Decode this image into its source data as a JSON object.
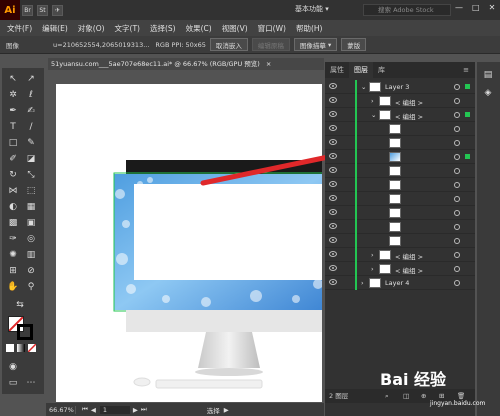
{
  "app": {
    "logo": "Ai"
  },
  "menu": {
    "items": [
      "文件(F)",
      "编辑(E)",
      "对象(O)",
      "文字(T)",
      "选择(S)",
      "效果(C)",
      "视图(V)",
      "窗口(W)",
      "帮助(H)"
    ],
    "workspace": "基本功能 ▾",
    "search_placeholder": "搜索 Adobe Stock",
    "mini_buttons": [
      "Br",
      "St"
    ]
  },
  "control_bar": {
    "label": "图像",
    "file_info": "u=210652554,2065019313...",
    "resolution": "RGB  PPI: 50x65",
    "embed_button": "取消嵌入",
    "edit_original": "编辑原稿",
    "image_trace": "图像描摹",
    "mask_button": "蒙版"
  },
  "document": {
    "tab_title": "51yuansu.com___5ae707e68ec11.ai*  @  66.67% (RGB/GPU 预览)",
    "close": "×"
  },
  "status": {
    "zoom": "66.67%",
    "page": "1",
    "mode": "选择"
  },
  "layers_panel": {
    "tabs": [
      "属性",
      "图层",
      "库"
    ],
    "active_tab": "图层",
    "rows": [
      {
        "name": "Layer 3",
        "indent": 0,
        "expanded": true,
        "selected_mark": true
      },
      {
        "name": "< 编组 >",
        "indent": 1,
        "expanded": false,
        "selected_mark": false
      },
      {
        "name": "< 编组 >",
        "indent": 1,
        "expanded": true,
        "selected_mark": true
      },
      {
        "name": "",
        "indent": 2,
        "expanded": false,
        "selected_mark": false
      },
      {
        "name": "",
        "indent": 2,
        "expanded": false,
        "selected_mark": false
      },
      {
        "name": "",
        "indent": 2,
        "expanded": false,
        "selected_mark": true
      },
      {
        "name": "",
        "indent": 2,
        "expanded": false,
        "selected_mark": false
      },
      {
        "name": "",
        "indent": 2,
        "expanded": false,
        "selected_mark": false
      },
      {
        "name": "",
        "indent": 2,
        "expanded": false,
        "selected_mark": false
      },
      {
        "name": "",
        "indent": 2,
        "expanded": false,
        "selected_mark": false
      },
      {
        "name": "",
        "indent": 2,
        "expanded": false,
        "selected_mark": false
      },
      {
        "name": "",
        "indent": 2,
        "expanded": false,
        "selected_mark": false
      },
      {
        "name": "< 编组 >",
        "indent": 1,
        "expanded": false,
        "selected_mark": false
      },
      {
        "name": "< 编组 >",
        "indent": 1,
        "expanded": false,
        "selected_mark": false
      },
      {
        "name": "Layer 4",
        "indent": 0,
        "expanded": false,
        "selected_mark": false
      }
    ],
    "footer": "2 图层"
  },
  "watermark": {
    "text": "Bai 经验",
    "sub": "jingyan.baidu.com"
  },
  "colors": {
    "accent_green": "#23c552",
    "arrow_red": "#e0282a",
    "logo_orange": "#ff9a00"
  }
}
